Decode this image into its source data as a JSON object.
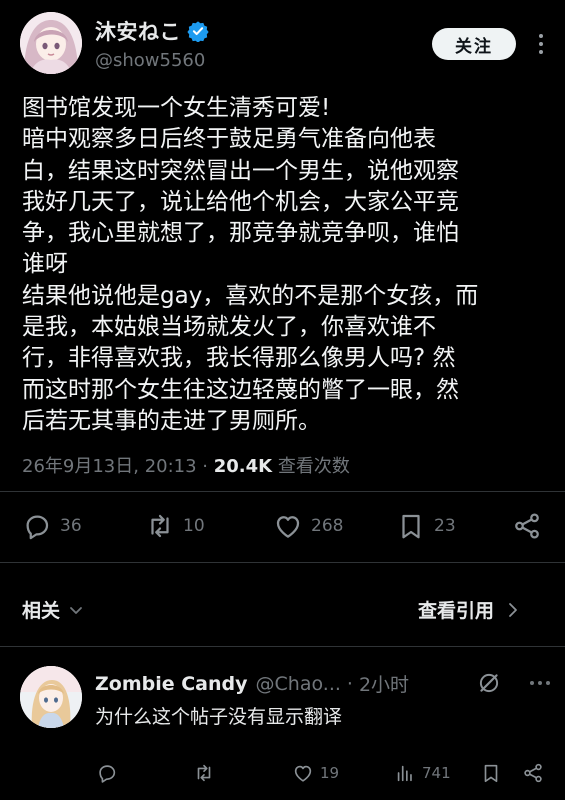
{
  "author": {
    "display_name": "沐安ねこ",
    "handle": "@show5560",
    "avatar_icon": "anime-girl-avatar",
    "verified_color": "#1d9bf0"
  },
  "follow_button": {
    "label": "关注"
  },
  "post": {
    "lines": [
      "图书馆发现一个女生清秀可爱!",
      "暗中观察多日后终于鼓足勇气准备向他表",
      "白，结果这时突然冒出一个男生，说他观察",
      "我好几天了，说让给他个机会，大家公平竞",
      "争，我心里就想了，那竞争就竞争呗，谁怕",
      "谁呀",
      "结果他说他是gay，喜欢的不是那个女孩，而",
      "是我，本姑娘当场就发火了，你喜欢谁不",
      "行，非得喜欢我，我长得那么像男人吗? 然",
      "而这时那个女生往这边轻蔑的瞥了一眼，然",
      "后若无其事的走进了男厕所。"
    ]
  },
  "meta": {
    "timestamp": "26年9月13日, 20:13",
    "separator": " · ",
    "views_count": "20.4K",
    "views_label": "查看次数"
  },
  "actions": {
    "replies": "36",
    "reposts": "10",
    "likes": "268",
    "bookmarks": "23"
  },
  "related": {
    "label": "相关",
    "quotes_label": "查看引用"
  },
  "reply": {
    "display_name": "Zombie Candy",
    "handle": "@Chao...",
    "dot": "·",
    "time": "2小时",
    "text": "为什么这个帖子没有显示翻译",
    "actions": {
      "replies": "",
      "reposts": "",
      "likes": "19",
      "views": "741"
    }
  },
  "colors": {
    "background": "#000000",
    "text_primary": "#e7e9ea",
    "text_secondary": "#71767b",
    "divider": "#2f3336",
    "accent": "#1d9bf0"
  }
}
